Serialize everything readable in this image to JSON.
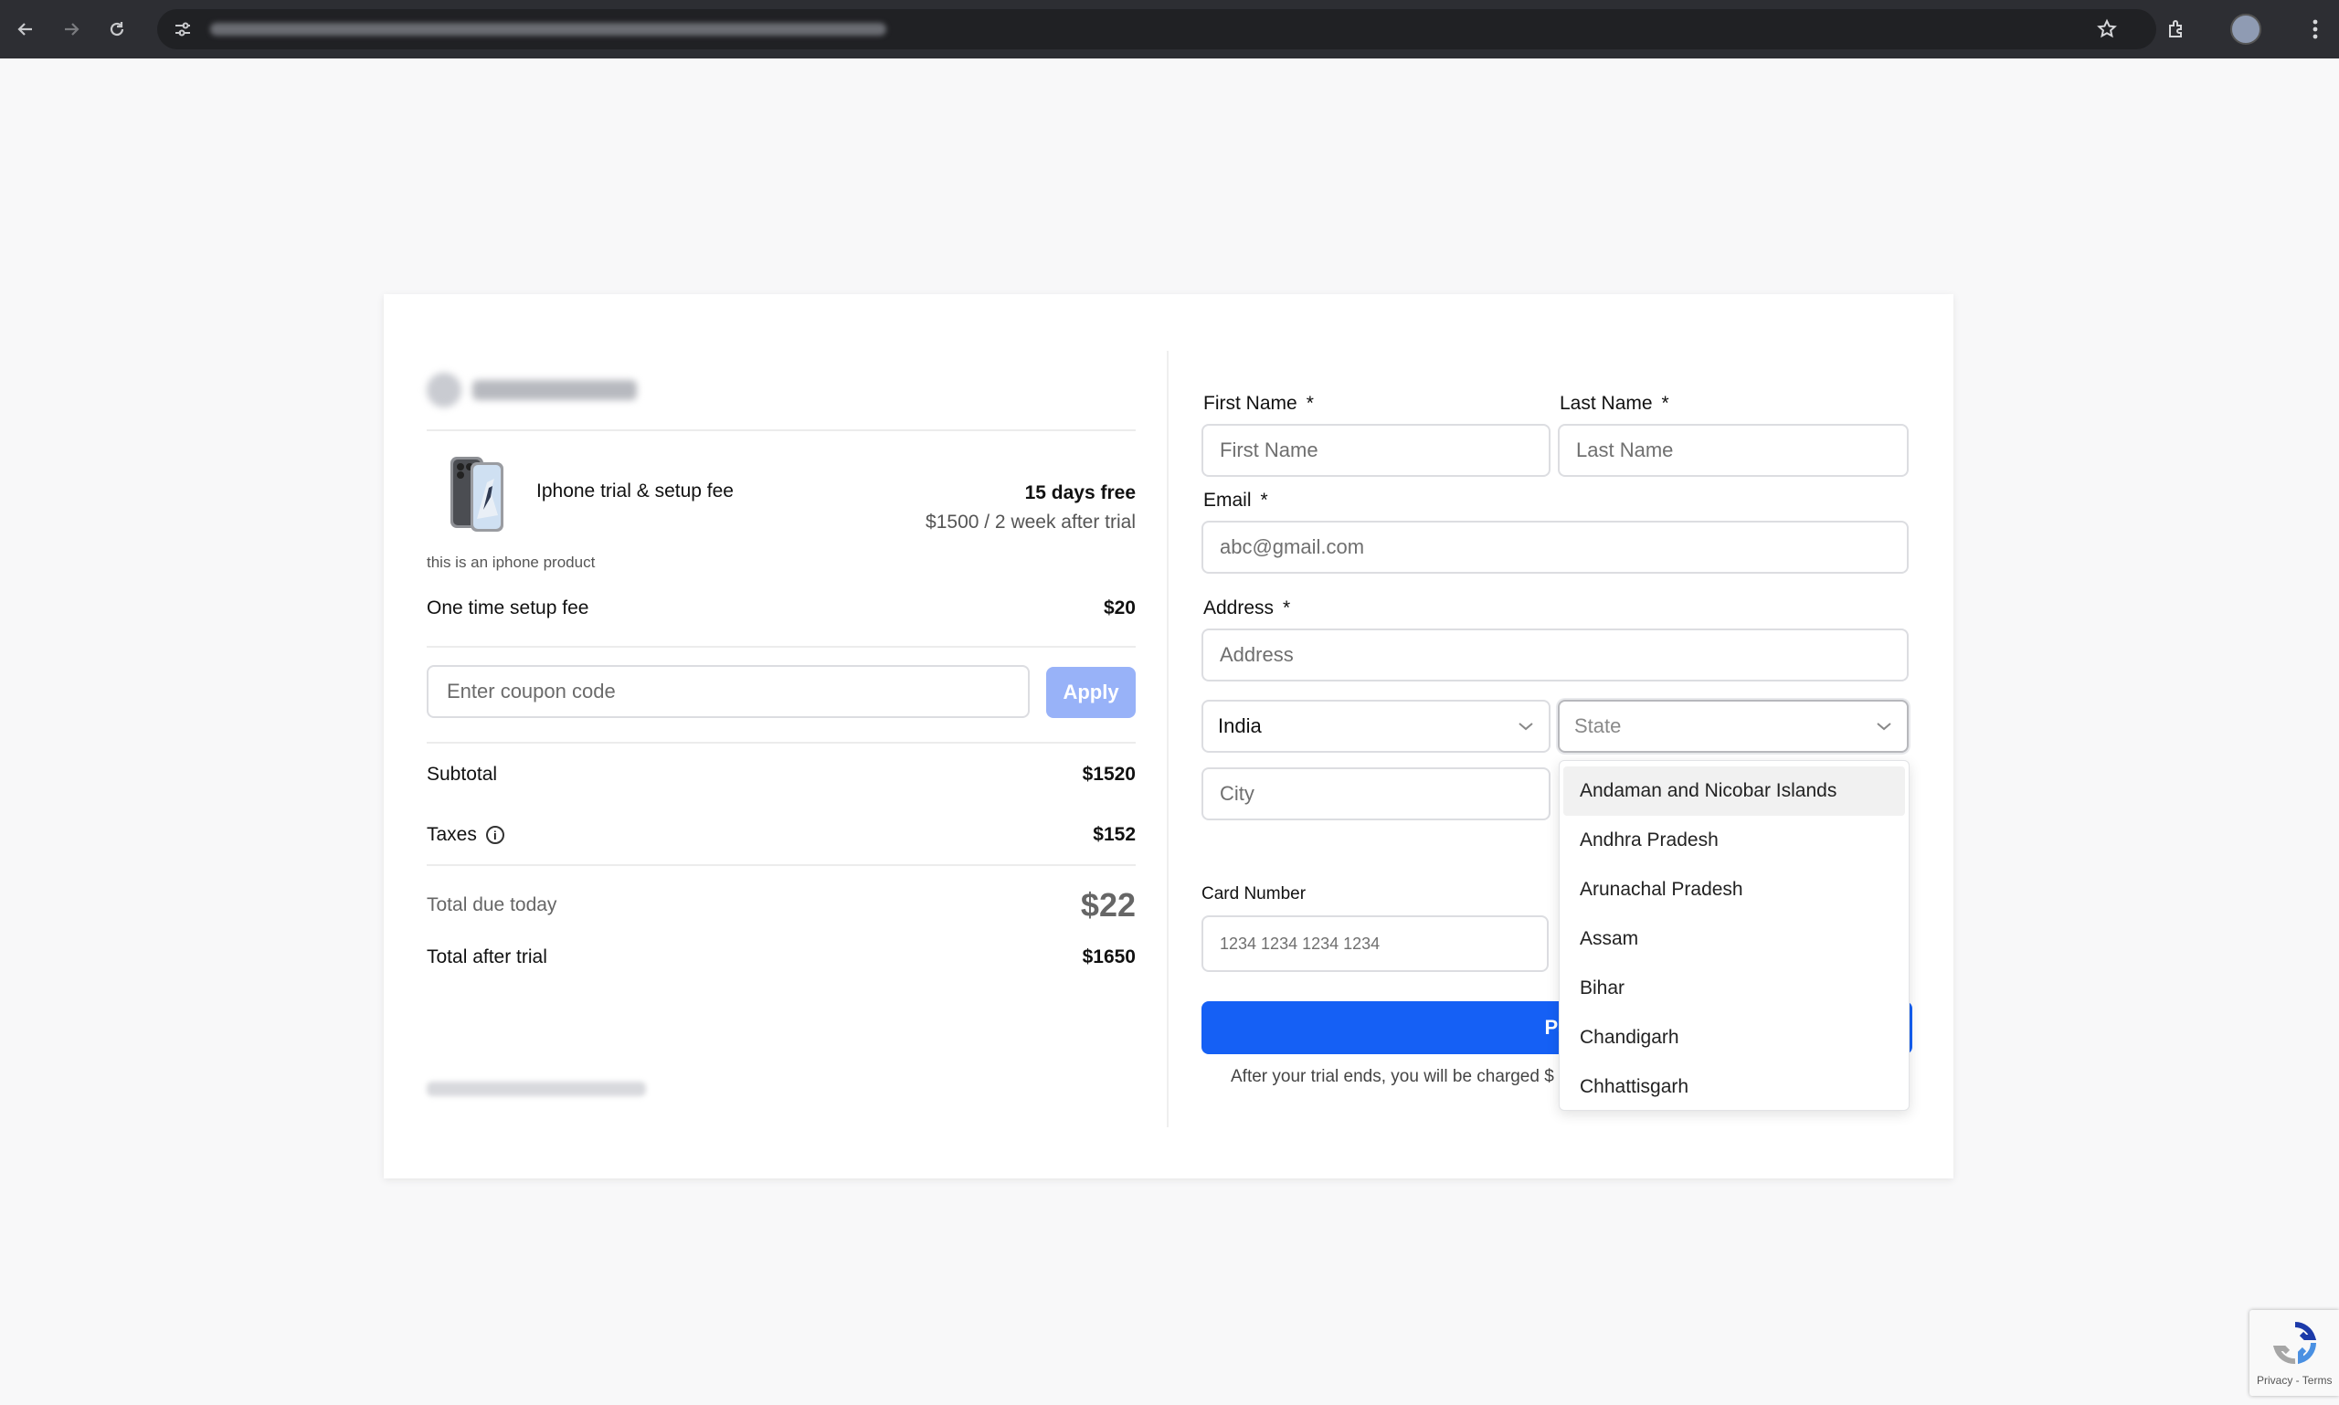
{
  "left_panel": {
    "product_title": "Iphone trial & setup fee",
    "trial_label": "15 days free",
    "trial_price_note": "$1500 / 2 week after trial",
    "product_description": "this is an iphone product",
    "setup_fee_label": "One time setup fee",
    "setup_fee_value": "$20",
    "coupon_placeholder": "Enter coupon code",
    "apply_label": "Apply",
    "subtotal_label": "Subtotal",
    "subtotal_value": "$1520",
    "taxes_label": "Taxes",
    "taxes_value": "$152",
    "total_due_label": "Total due today",
    "total_due_value": "$22",
    "total_after_trial_label": "Total after trial",
    "total_after_trial_value": "$1650"
  },
  "form": {
    "first_name_label": "First Name",
    "first_name_placeholder": "First Name",
    "last_name_label": "Last Name",
    "last_name_placeholder": "Last Name",
    "email_label": "Email",
    "email_placeholder": "abc@gmail.com",
    "address_label": "Address",
    "address_placeholder": "Address",
    "required_mark": "*",
    "country_value": "India",
    "state_placeholder": "State",
    "city_placeholder": "City",
    "card_number_label": "Card Number",
    "card_number_placeholder": "1234 1234 1234 1234",
    "pay_label": "Pa",
    "trial_note": "After your trial ends, you will be charged $"
  },
  "state_dropdown": {
    "options": [
      "Andaman and Nicobar Islands",
      "Andhra Pradesh",
      "Arunachal Pradesh",
      "Assam",
      "Bihar",
      "Chandigarh",
      "Chhattisgarh"
    ]
  },
  "recaptcha": {
    "terms_text": "Privacy - Terms"
  },
  "colors": {
    "primary": "#1560f5",
    "apply_disabled": "#98b2f8"
  }
}
